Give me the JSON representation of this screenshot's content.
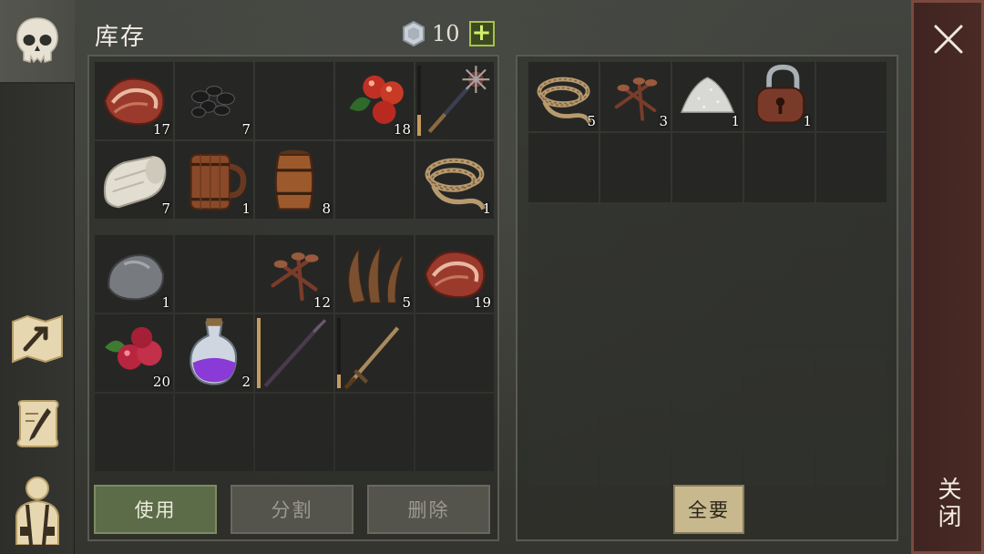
{
  "screen_title": "库存",
  "currency": {
    "icon": "silver-coin-icon",
    "count": "10",
    "add_label": "+"
  },
  "nav": [
    {
      "name": "skull-icon",
      "active": true
    },
    {
      "name": "crafting-map-icon",
      "active": false
    },
    {
      "name": "quest-scroll-icon",
      "active": false
    },
    {
      "name": "character-equipment-icon",
      "active": false
    }
  ],
  "inventory_top": [
    {
      "icon": "bacon-icon",
      "qty": "17"
    },
    {
      "icon": "coal-icon",
      "qty": "7"
    },
    {
      "icon": "",
      "qty": ""
    },
    {
      "icon": "berries-icon",
      "qty": "18"
    },
    {
      "icon": "mace-icon",
      "qty": "",
      "durability": 0.3
    },
    {
      "icon": "cloth-roll-icon",
      "qty": "7"
    },
    {
      "icon": "wooden-mug-icon",
      "qty": "1"
    },
    {
      "icon": "barrel-icon",
      "qty": "8"
    },
    {
      "icon": "",
      "qty": ""
    },
    {
      "icon": "rope-icon",
      "qty": "1"
    }
  ],
  "inventory_bottom": [
    {
      "icon": "stone-icon",
      "qty": "1"
    },
    {
      "icon": "",
      "qty": ""
    },
    {
      "icon": "nails-icon",
      "qty": "12"
    },
    {
      "icon": "plant-fiber-icon",
      "qty": "5"
    },
    {
      "icon": "bacon-icon",
      "qty": "19"
    },
    {
      "icon": "red-berries-icon",
      "qty": "20"
    },
    {
      "icon": "potion-icon",
      "qty": "2"
    },
    {
      "icon": "spear-icon",
      "qty": "",
      "durability": 1.0
    },
    {
      "icon": "sword-icon",
      "qty": "",
      "durability": 0.2
    },
    {
      "icon": "",
      "qty": ""
    },
    {
      "icon": "",
      "qty": ""
    },
    {
      "icon": "",
      "qty": ""
    },
    {
      "icon": "",
      "qty": ""
    },
    {
      "icon": "",
      "qty": ""
    },
    {
      "icon": "",
      "qty": ""
    }
  ],
  "container_items": [
    {
      "icon": "rope-icon",
      "qty": "5"
    },
    {
      "icon": "nails-icon",
      "qty": "3"
    },
    {
      "icon": "salt-pile-icon",
      "qty": "1"
    },
    {
      "icon": "padlock-icon",
      "qty": "1"
    }
  ],
  "buttons": {
    "use": "使用",
    "split": "分割",
    "delete": "删除",
    "take_all": "全要",
    "close": "关闭"
  }
}
